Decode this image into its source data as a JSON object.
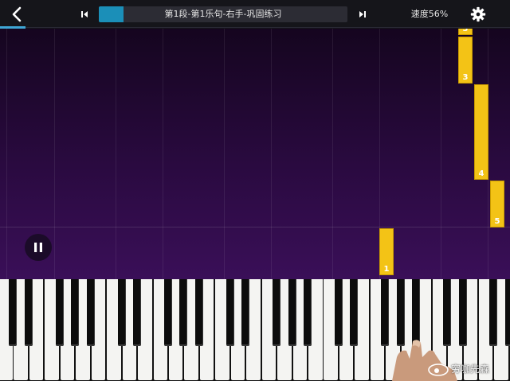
{
  "toolbar": {
    "lesson_title": "第1段-第1乐句-右手-巩固练习",
    "progress_fraction": 0.1,
    "speed_label": "速度56%"
  },
  "notes": [
    {
      "finger": "3"
    },
    {
      "finger": "4"
    },
    {
      "finger": "5"
    },
    {
      "finger": "1"
    }
  ],
  "watermark": {
    "text": "穷咖先森"
  },
  "colors": {
    "roll_top": "#15051f",
    "roll_bottom": "#3a0f58",
    "note": "#f3c316",
    "progress_fill": "#1b8fb8",
    "accent": "#3fa7d6"
  },
  "icons": [
    "back-arrow-icon",
    "skip-previous-icon",
    "skip-next-icon",
    "gear-icon",
    "pause-icon"
  ]
}
